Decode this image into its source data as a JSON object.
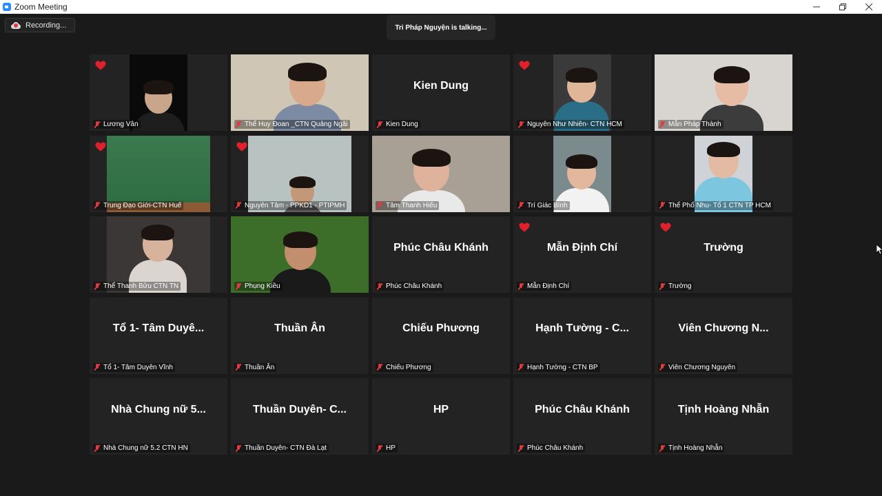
{
  "window": {
    "title": "Zoom Meeting",
    "controls": [
      "minimize",
      "maximize",
      "close"
    ]
  },
  "recording": {
    "label": "Recording..."
  },
  "talking": {
    "text": "Tri Pháp Nguyện is talking..."
  },
  "colors": {
    "muted_red": "#e0393e",
    "tile_bg": "#232323",
    "heart": "#e0202a"
  },
  "participants": [
    {
      "label": "Lương Vân",
      "center": "",
      "video": true,
      "heart": true,
      "muted": true
    },
    {
      "label": "Thể Huy Đoan _CTN Quảng Ngãi",
      "center": "",
      "video": true,
      "heart": false,
      "muted": true
    },
    {
      "label": "Kien Dung",
      "center": "Kien Dung",
      "video": false,
      "heart": false,
      "muted": true
    },
    {
      "label": "Nguyên Như Nhiên- CTN HCM",
      "center": "",
      "video": true,
      "heart": true,
      "muted": true
    },
    {
      "label": "Mẫn Pháp Thành",
      "center": "",
      "video": true,
      "heart": false,
      "muted": true
    },
    {
      "label": "Trung Đạo Giới-CTN Huế",
      "center": "",
      "video": true,
      "heart": true,
      "muted": true
    },
    {
      "label": "Nguyên Tâm - PPKD1 - PTIPMH",
      "center": "",
      "video": true,
      "heart": true,
      "muted": true
    },
    {
      "label": "Tâm Thanh Hiếu",
      "center": "",
      "video": true,
      "heart": false,
      "muted": true
    },
    {
      "label": "Trí Giác Bình",
      "center": "",
      "video": true,
      "heart": false,
      "muted": true
    },
    {
      "label": "Thể Phổ Nhu- Tổ 1 CTN TP HCM",
      "center": "",
      "video": true,
      "heart": false,
      "muted": true
    },
    {
      "label": "Thể Thanh Bửu CTN TN",
      "center": "",
      "video": true,
      "heart": false,
      "muted": true
    },
    {
      "label": "Phụng Kiều",
      "center": "",
      "video": true,
      "heart": false,
      "muted": true
    },
    {
      "label": "Phúc Châu Khánh",
      "center": "Phúc Châu Khánh",
      "video": false,
      "heart": false,
      "muted": true
    },
    {
      "label": "Mẫn Định Chí",
      "center": "Mẫn Định Chí",
      "video": false,
      "heart": true,
      "muted": true
    },
    {
      "label": "Trường",
      "center": "Trường",
      "video": false,
      "heart": true,
      "muted": true
    },
    {
      "label": "Tổ 1- Tâm Duyên Vĩnh",
      "center": "Tổ 1- Tâm Duyê...",
      "video": false,
      "heart": false,
      "muted": true
    },
    {
      "label": "Thuần Ân",
      "center": "Thuần Ân",
      "video": false,
      "heart": false,
      "muted": true
    },
    {
      "label": "Chiếu Phương",
      "center": "Chiếu Phương",
      "video": false,
      "heart": false,
      "muted": true
    },
    {
      "label": "Hạnh Tường - CTN BP",
      "center": "Hạnh Tường - C...",
      "video": false,
      "heart": false,
      "muted": true
    },
    {
      "label": "Viên Chương Nguyên",
      "center": "Viên Chương N...",
      "video": false,
      "heart": false,
      "muted": true
    },
    {
      "label": "Nhà Chung nữ 5.2 CTN HN",
      "center": "Nhà Chung nữ 5...",
      "video": false,
      "heart": false,
      "muted": true
    },
    {
      "label": "Thuần Duyên- CTN Đà Lạt",
      "center": "Thuần Duyên- C...",
      "video": false,
      "heart": false,
      "muted": true
    },
    {
      "label": "HP",
      "center": "HP",
      "video": false,
      "heart": false,
      "muted": true
    },
    {
      "label": "Phúc Châu Khánh",
      "center": "Phúc Châu Khánh",
      "video": false,
      "heart": false,
      "muted": true
    },
    {
      "label": "Tịnh Hoàng Nhẫn",
      "center": "Tịnh Hoàng Nhẫn",
      "video": false,
      "heart": false,
      "muted": true
    }
  ]
}
